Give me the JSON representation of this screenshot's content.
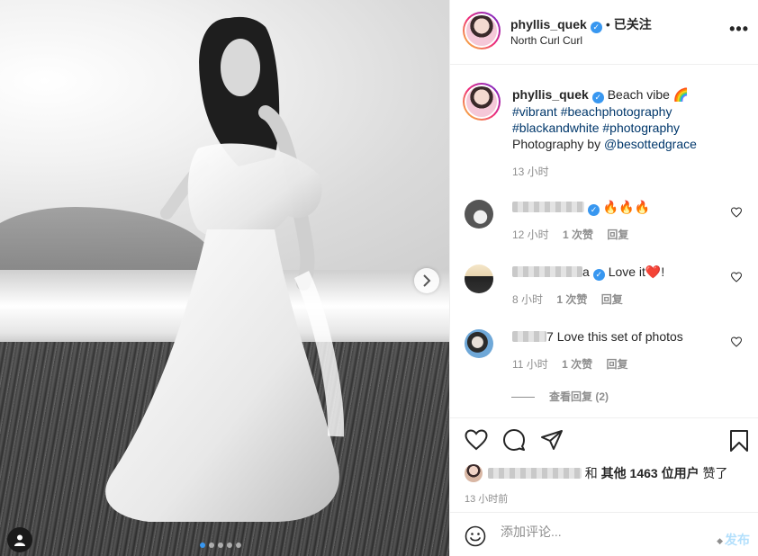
{
  "post": {
    "username": "phyllis_quek",
    "follow_status": "已关注",
    "location": "North Curl Curl",
    "carousel_index": 1,
    "carousel_total": 5
  },
  "caption": {
    "username": "phyllis_quek",
    "text": "Beach vibe 🌈",
    "hashtags_line1": "#vibrant #beachphotography",
    "hashtags_line2": "#blackandwhite #photography",
    "credit_prefix": "Photography by ",
    "credit_mention": "@besottedgrace",
    "time": "13 小时"
  },
  "comments": [
    {
      "name_visible": "",
      "text": "🔥🔥🔥",
      "time": "12 小时",
      "likes": "1 次赞",
      "reply": "回复"
    },
    {
      "name_visible": "a",
      "text": "Love it❤️!",
      "time": "8 小时",
      "likes": "1 次赞",
      "reply": "回复"
    },
    {
      "name_visible": "7",
      "text": "Love this set of photos",
      "time": "11 小时",
      "likes": "1 次赞",
      "reply": "回复"
    }
  ],
  "view_replies": "查看回复 (2)",
  "likes": {
    "suffix_and": "和",
    "others": "其他 1463 位用户",
    "liked": "赞了"
  },
  "post_time": "13 小时前",
  "add_comment": {
    "placeholder": "添加评论...",
    "post_label": "发布"
  },
  "colors": {
    "link": "#00376b",
    "verified": "#3897f0",
    "post_disabled": "#b2dffc",
    "muted": "#8e8e8e"
  }
}
